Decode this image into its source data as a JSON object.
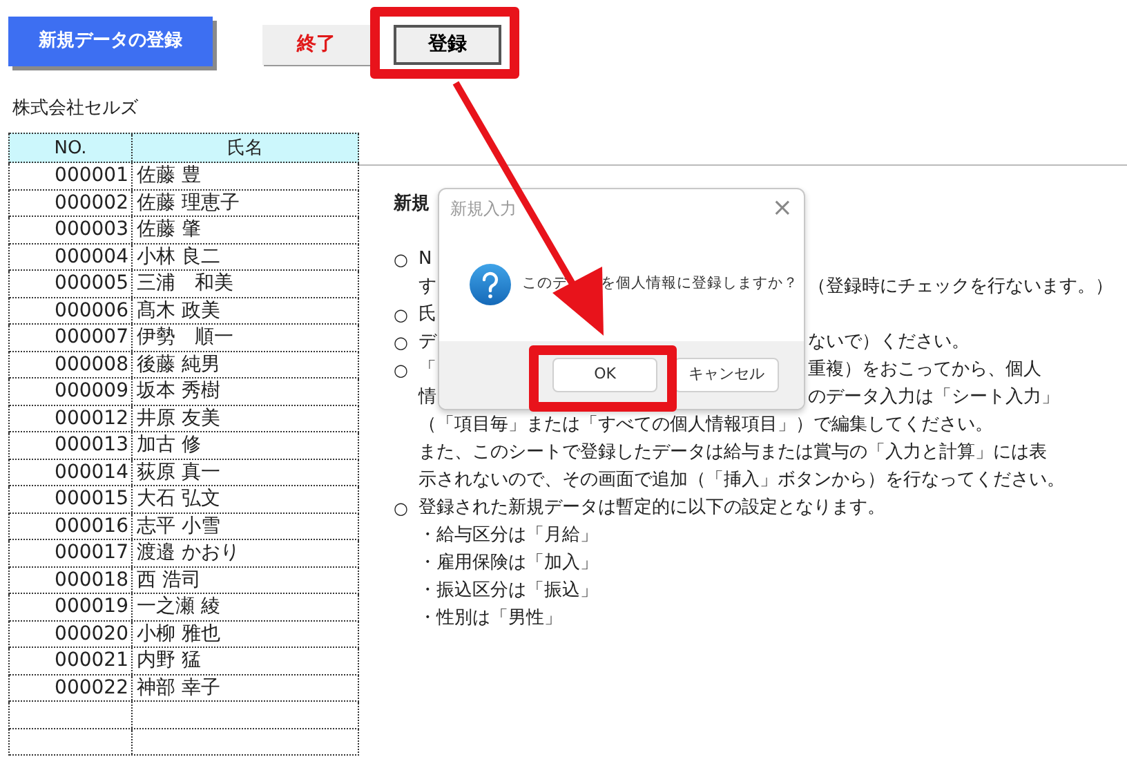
{
  "toolbar": [
    {
      "label": "新規データの登録",
      "kind": "primary"
    },
    {
      "label": "終了",
      "kind": "exit"
    },
    {
      "label": "登録",
      "kind": "register",
      "highlighted": true
    }
  ],
  "company": "株式会社セルズ",
  "table": {
    "columns": [
      "NO.",
      "氏名"
    ],
    "rows": [
      {
        "no": "000001",
        "name": "佐藤 豊"
      },
      {
        "no": "000002",
        "name": "佐藤 理恵子"
      },
      {
        "no": "000003",
        "name": "佐藤 肇"
      },
      {
        "no": "000004",
        "name": "小林 良二"
      },
      {
        "no": "000005",
        "name": "三浦　和美"
      },
      {
        "no": "000006",
        "name": "髙木 政美"
      },
      {
        "no": "000007",
        "name": "伊勢　順一"
      },
      {
        "no": "000008",
        "name": "後藤 純男"
      },
      {
        "no": "000009",
        "name": "坂本 秀樹"
      },
      {
        "no": "000012",
        "name": "井原 友美"
      },
      {
        "no": "000013",
        "name": "加古 修"
      },
      {
        "no": "000014",
        "name": "荻原 真一"
      },
      {
        "no": "000015",
        "name": "大石 弘文"
      },
      {
        "no": "000016",
        "name": "志平 小雪"
      },
      {
        "no": "000017",
        "name": "渡邉 かおり"
      },
      {
        "no": "000018",
        "name": "西 浩司"
      },
      {
        "no": "000019",
        "name": "一之瀬 綾"
      },
      {
        "no": "000020",
        "name": "小柳 雅也"
      },
      {
        "no": "000021",
        "name": "内野 猛"
      },
      {
        "no": "000022",
        "name": "神部 幸子"
      }
    ]
  },
  "notes": {
    "heading": "新規",
    "lines": [
      {
        "kind": "spacer"
      },
      {
        "kind": "bullet",
        "mark": "○",
        "left": "N"
      },
      {
        "kind": "text",
        "left": "す",
        "right": "（登録時にチェックを行ないます。）"
      },
      {
        "kind": "bullet",
        "mark": "○",
        "left": "氏"
      },
      {
        "kind": "bullet",
        "mark": "○",
        "left": "デ",
        "right": "ないで）ください。"
      },
      {
        "kind": "bullet",
        "mark": "○",
        "left": "「",
        "right": "重複）をおこってから、個人"
      },
      {
        "kind": "text",
        "left": "情",
        "right": "のデータ入力は「シート入力」"
      },
      {
        "kind": "text",
        "left": "（「項目毎」または「すべての個人情報項目」）で編集してください。"
      },
      {
        "kind": "text",
        "left": "また、このシートで登録したデータは給与または賞与の「入力と計算」には表"
      },
      {
        "kind": "text",
        "left": "示されないので、その画面で追加（「挿入」ボタンから）を行なってください。"
      },
      {
        "kind": "bullet",
        "mark": "○",
        "left": "登録された新規データは暫定的に以下の設定となります。"
      },
      {
        "kind": "text",
        "left": "・給与区分は「月給」"
      },
      {
        "kind": "text",
        "left": "・雇用保険は「加入」"
      },
      {
        "kind": "text",
        "left": "・振込区分は「振込」"
      },
      {
        "kind": "text",
        "left": "・性別は「男性」"
      }
    ]
  },
  "dialog": {
    "title": "新規入力",
    "close": "×",
    "message": [
      "このデ",
      "を個人情報に登録しますか？"
    ],
    "buttons": [
      {
        "label": "OK",
        "highlighted": true
      },
      {
        "label": "キャンセル"
      }
    ]
  }
}
